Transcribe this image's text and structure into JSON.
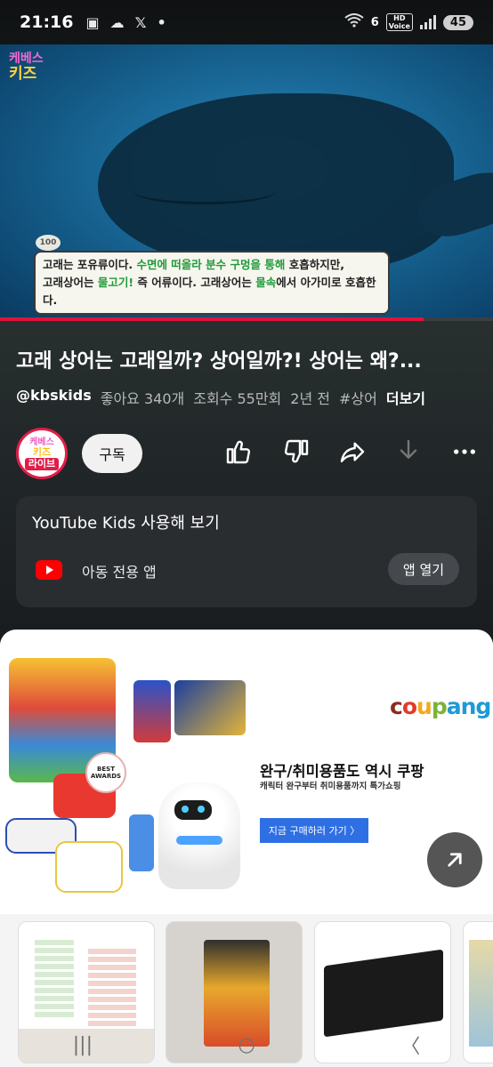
{
  "status_bar": {
    "time": "21:16",
    "net_label": "6",
    "hd_label": "HD",
    "voice_label": "Voice",
    "battery": "45"
  },
  "video": {
    "channel_logo_top": "케베스",
    "channel_logo_bottom": "키즈",
    "badge": "100",
    "subtitle_line1_a": "고래는 포유류이다. ",
    "subtitle_line1_b": "수면에 떠올라 분수 구멍을 통해",
    "subtitle_line1_c": " 호흡하지만,",
    "subtitle_line2_a": "고래상어는 ",
    "subtitle_line2_b": "물고기!",
    "subtitle_line2_c": " 즉 어류이다. 고래상어는 ",
    "subtitle_line2_d": "물속",
    "subtitle_line2_e": "에서 아가미로 호흡한다.",
    "progress": 0.86
  },
  "title": "고래 상어는 고래일까? 상어일까?! 상어는 왜?...",
  "meta": {
    "handle": "@kbskids",
    "likes": "좋아요 340개",
    "views": "조회수 55만회",
    "age": "2년 전",
    "tag": "#상어",
    "more": "더보기"
  },
  "channel_avatar": {
    "line1": "케베스",
    "line2": "키즈",
    "line3": "라이브"
  },
  "actions": {
    "subscribe": "구독",
    "like_icon": "thumbs-up-icon",
    "dislike_icon": "thumbs-down-icon",
    "share_icon": "share-icon",
    "download_icon": "download-icon",
    "more_icon": "more-icon"
  },
  "yt_kids": {
    "title": "YouTube Kids 사용해 보기",
    "subtitle": "아동 전용 앱",
    "button": "앱 열기"
  },
  "ad": {
    "brand": [
      "c",
      "o",
      "u",
      "p",
      "a",
      "n",
      "g"
    ],
    "headline": "완구/취미용품도 역시 쿠팡",
    "subline": "캐릭터 완구부터 취미용품까지 특가쇼핑",
    "cta": "지금 구매하러 가기 〉",
    "award": "BEST AWARDS"
  },
  "colors": {
    "accent_red": "#e1133a",
    "cta_blue": "#2f6fe4"
  },
  "navbar": {
    "recent": "|||",
    "home": "○",
    "back": "〈"
  }
}
